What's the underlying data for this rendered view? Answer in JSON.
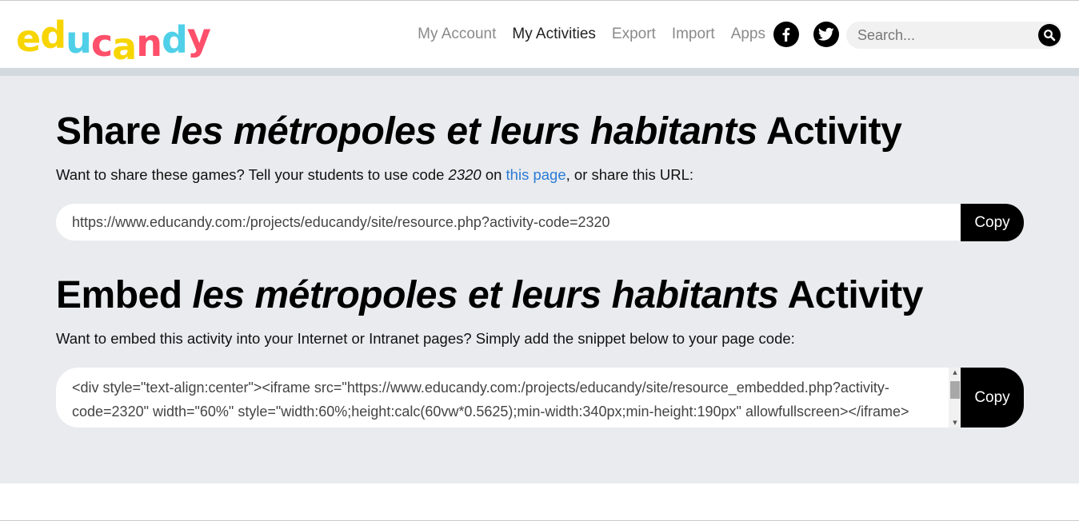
{
  "header": {
    "logo_letters": [
      {
        "char": "e",
        "color": "#f7d500"
      },
      {
        "char": "d",
        "color": "#f7d500"
      },
      {
        "char": "u",
        "color": "#4fd0e8"
      },
      {
        "char": "C",
        "color": "#ff4f6a"
      },
      {
        "char": "A",
        "color": "#f7d500"
      },
      {
        "char": "N",
        "color": "#ff4f6a"
      },
      {
        "char": "D",
        "color": "#4fd0e8"
      },
      {
        "char": "Y",
        "color": "#ff4f6a"
      }
    ],
    "nav": [
      {
        "label": "My Account",
        "active": false
      },
      {
        "label": "My Activities",
        "active": true
      },
      {
        "label": "Export",
        "active": false
      },
      {
        "label": "Import",
        "active": false
      },
      {
        "label": "Apps",
        "active": false
      }
    ],
    "social": {
      "facebook_icon": "facebook-icon",
      "twitter_icon": "twitter-icon"
    },
    "search": {
      "placeholder": "Search...",
      "icon": "search-icon"
    }
  },
  "share": {
    "title_prefix": "Share",
    "title_name": "les métropoles et leurs habitants",
    "title_suffix": "Activity",
    "desc_part1": "Want to share these games? Tell your students to use code",
    "code": "2320",
    "desc_part2": "on",
    "link_text": "this page",
    "desc_part3": ", or share this URL:",
    "url": "https://www.educandy.com:/projects/educandy/site/resource.php?activity-code=2320",
    "copy_label": "Copy"
  },
  "embed": {
    "title_prefix": "Embed",
    "title_name": "les métropoles et leurs habitants",
    "title_suffix": "Activity",
    "desc": "Want to embed this activity into your Internet or Intranet pages? Simply add the snippet below to your page code:",
    "snippet": "<div style=\"text-align:center\"><iframe src=\"https://www.educandy.com:/projects/educandy/site/resource_embedded.php?activity-code=2320\" width=\"60%\" style=\"width:60%;height:calc(60vw*0.5625);min-width:340px;min-height:190px\" allowfullscreen></iframe></div>",
    "copy_label": "Copy"
  }
}
